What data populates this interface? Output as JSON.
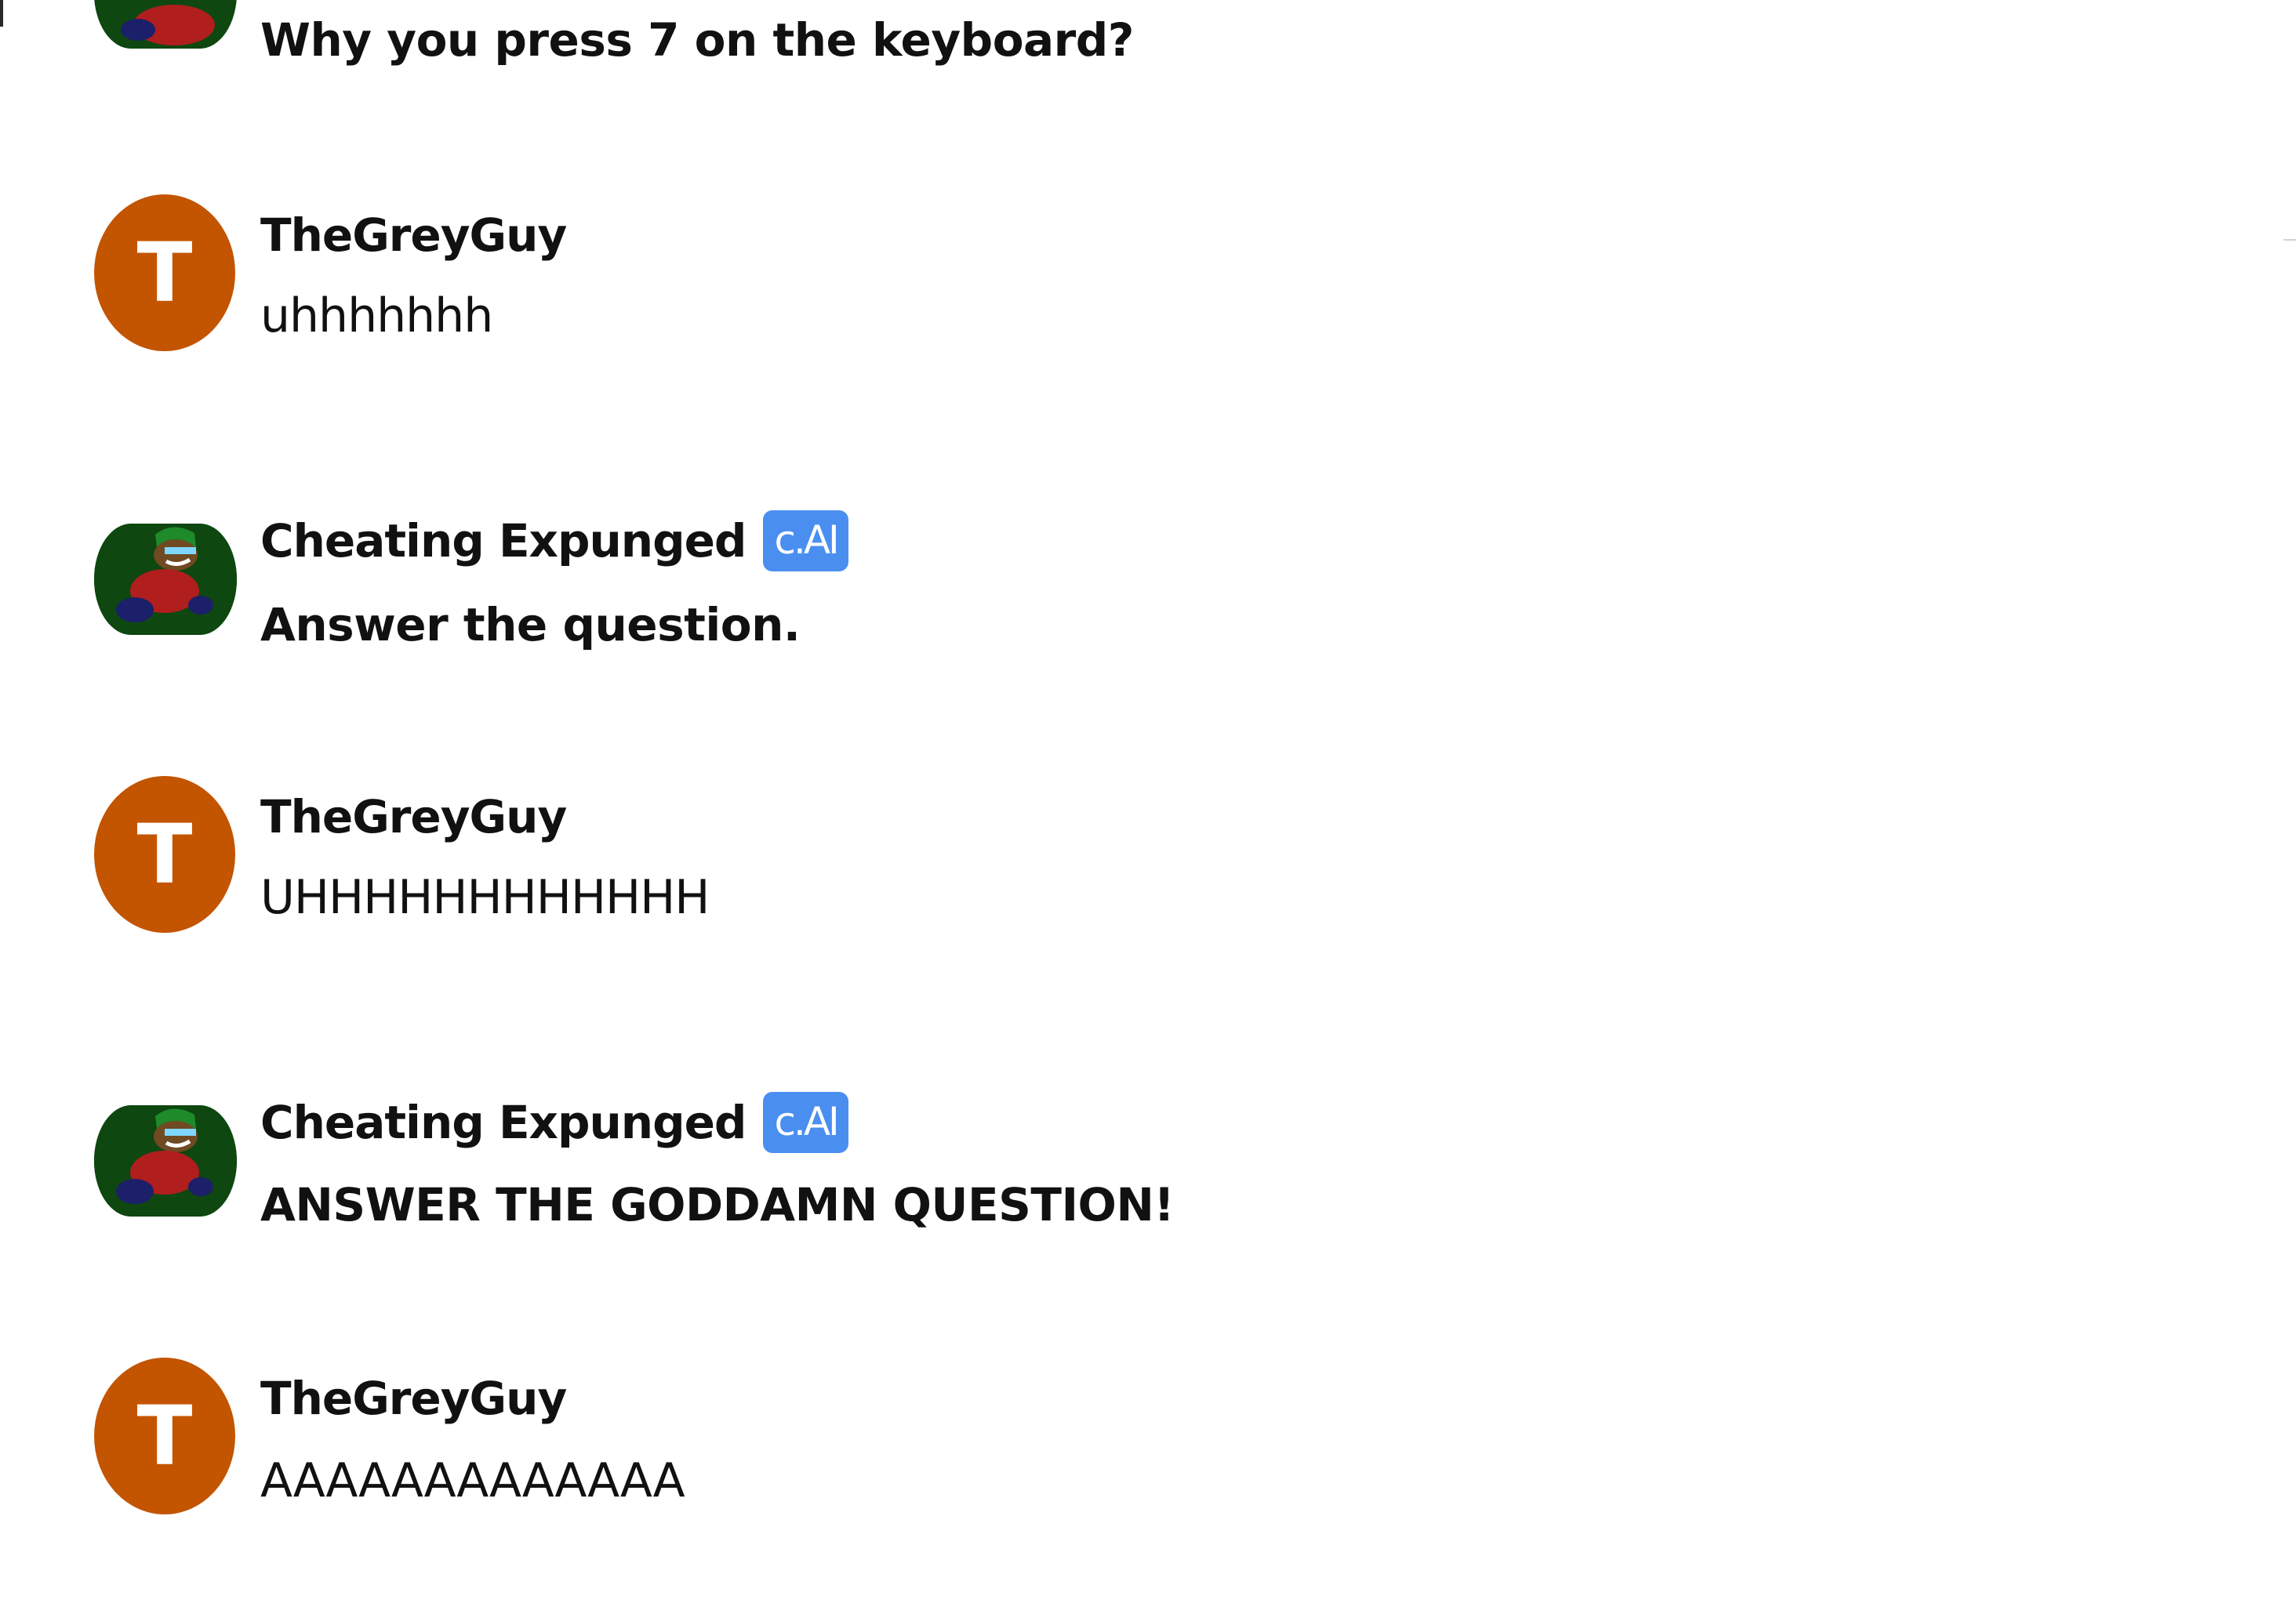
{
  "colors": {
    "user_avatar_bg": "#c35400",
    "badge_bg": "#4a8ff0",
    "text": "#111111",
    "bot_avatar_bg": "#0e4710"
  },
  "icons": {
    "bot_avatar": "green-cap-character-avatar",
    "user_avatar": "letter-avatar"
  },
  "messages": [
    {
      "sender": "",
      "badge": "",
      "text": "Why you press 7 on the keyboard?",
      "role": "bot"
    },
    {
      "sender": "TheGreyGuy",
      "avatar_letter": "T",
      "text": "uhhhhhhh",
      "role": "user"
    },
    {
      "sender": "Cheating Expunged",
      "badge": "c.AI",
      "text": "Answer the question.",
      "role": "bot"
    },
    {
      "sender": "TheGreyGuy",
      "avatar_letter": "T",
      "text": "UHHHHHHHHHHHH",
      "role": "user"
    },
    {
      "sender": "Cheating Expunged",
      "badge": "c.AI",
      "text": "ANSWER THE GODDAMN QUESTION!",
      "role": "bot"
    },
    {
      "sender": "TheGreyGuy",
      "avatar_letter": "T",
      "text": "AAAAAAAAAAAAA",
      "role": "user"
    }
  ]
}
